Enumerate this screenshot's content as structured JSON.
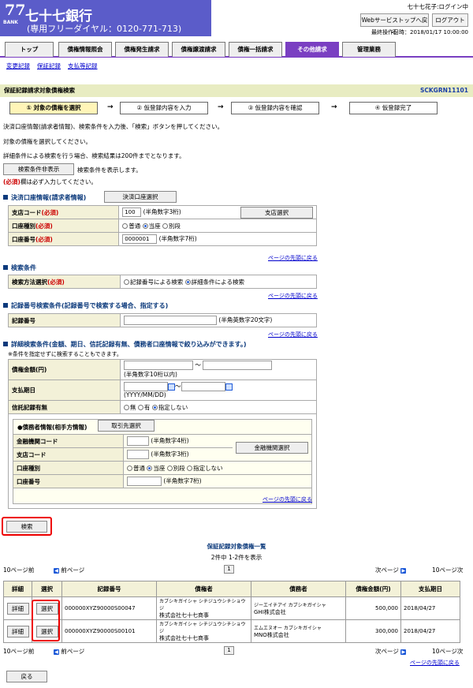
{
  "header": {
    "logo_mark": "77",
    "logo_sub": "BANK",
    "bank_name": "七十七銀行",
    "free_dial": "(専用フリーダイヤル：0120-771-713)",
    "user_status": "七十七花子:ログイン中",
    "web_top_button": "Webサービストップへ戻る",
    "logout_button": "ログアウト",
    "last_operation": "最終操作日時：2018/01/17 10:00:00"
  },
  "tabs": [
    {
      "label": "トップ"
    },
    {
      "label": "債権情報照会"
    },
    {
      "label": "債権発生請求"
    },
    {
      "label": "債権譲渡請求"
    },
    {
      "label": "債権一括請求"
    },
    {
      "label": "その他請求"
    },
    {
      "label": "管理業務"
    }
  ],
  "sublinks": [
    "変更記録",
    "保証記録",
    "支払等記録"
  ],
  "page": {
    "title": "保証記録請求対象債権検索",
    "code": "SCKGRN11101"
  },
  "steps": [
    {
      "label": "① 対象の債権を選択"
    },
    {
      "label": "② 仮登録内容を入力"
    },
    {
      "label": "③ 仮登録内容を確認"
    },
    {
      "label": "④ 仮登録完了"
    }
  ],
  "intro": {
    "line1": "決済口座情報(請求者情報)、検索条件を入力後、「検索」ボタンを押してください。",
    "line2": "対象の債権を選択してください。",
    "line3": "詳細条件による検索を行う場合、検索結果は200件までとなります。",
    "toggle_button": "検索条件非表示",
    "toggle_note": "検索条件を表示します。",
    "required_mark": "(必須)",
    "required_note": "欄は必ず入力してください。"
  },
  "settlement": {
    "heading": "決済口座情報(請求者情報)",
    "select_button": "決済口座選択",
    "branch_label": "支店コード",
    "branch_value": "100",
    "branch_hint": "(半角数字3桁)",
    "branch_button": "支店選択",
    "account_type_label": "口座種別",
    "opt_normal": "普通",
    "opt_current": "当座",
    "opt_separate": "別段",
    "account_no_label": "口座番号",
    "account_no_value": "0000001",
    "account_no_hint": "(半角数字7桁)",
    "required": "(必須)"
  },
  "top_link": "ページの先頭に戻る",
  "search_cond": {
    "heading": "検索条件",
    "method_label": "検索方法選択",
    "opt_record": "記録番号による検索",
    "opt_detail": "詳細条件による検索",
    "required": "(必須)"
  },
  "record_cond": {
    "heading": "記録番号検索条件(記録番号で検索する場合、指定する)",
    "label": "記録番号",
    "hint": "(半角英数字20文字)"
  },
  "detail_cond": {
    "heading": "詳細検索条件(金額、期日、信託記録有無、債務者口座情報で絞り込みができます。)",
    "note": "※条件を指定せずに検索することもできます。",
    "amount_label": "債権金額(円)",
    "amount_hint": "(半角数字10桁以内)",
    "tilde": "～",
    "due_label": "支払期日",
    "due_hint": "(YYYY/MM/DD)",
    "trust_label": "信託記録有無",
    "opt_none": "無",
    "opt_yes": "有",
    "opt_unspecified": "指定しない",
    "debtor_heading": "●債務者情報(相手方情報)",
    "partner_button": "取引先選択",
    "bank_code_label": "金融機関コード",
    "bank_code_hint": "(半角数字4桁)",
    "bank_select_button": "金融機関選択",
    "branch_code_label": "支店コード",
    "branch_code_hint": "(半角数字3桁)",
    "account_type_label": "口座種別",
    "opt_normal": "普通",
    "opt_current": "当座",
    "opt_separate": "別段",
    "account_no_label": "口座番号",
    "account_no_hint": "(半角数字7桁)"
  },
  "search_button": "検索",
  "results": {
    "title": "保証記録対象債権一覧",
    "count": "2件中 1-2件を表示",
    "prev10": "10ページ前",
    "prev": "前ページ",
    "page": "1",
    "next": "次ページ",
    "next10": "10ページ次",
    "headers": [
      "詳細",
      "選択",
      "記録番号",
      "債権者",
      "債務者",
      "債権金額(円)",
      "支払期日"
    ],
    "rows": [
      {
        "detail": "詳細",
        "select": "選択",
        "record_no": "000000XYZ90000S00047",
        "creditor_kana": "カブシキガイシャ シチジュウシチショウジ",
        "creditor": "株式会社七十七商事",
        "debtor_kana": "ジーエイチアイ カブシキガイシャ",
        "debtor": "GHI株式会社",
        "amount": "500,000",
        "due": "2018/04/27"
      },
      {
        "detail": "詳細",
        "select": "選択",
        "record_no": "000000XYZ90000S00101",
        "creditor_kana": "カブシキガイシャ シチジュウシチショウジ",
        "creditor": "株式会社七十七商事",
        "debtor_kana": "エムエヌオー カブシキガイシャ",
        "debtor": "MNO株式会社",
        "amount": "300,000",
        "due": "2018/04/27"
      }
    ]
  },
  "back_button": "戻る"
}
